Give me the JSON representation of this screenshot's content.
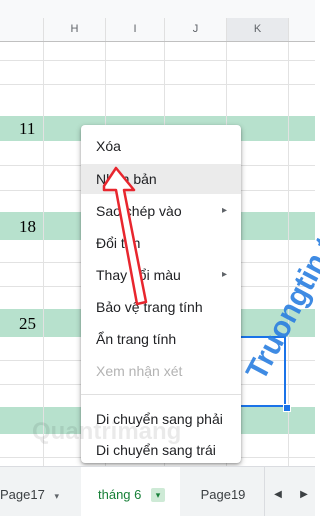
{
  "columns": {
    "h": "H",
    "i": "I",
    "j": "J",
    "k": "K"
  },
  "rows": {
    "r1": "11",
    "r2": "18",
    "r3": "25"
  },
  "menu": {
    "delete": "Xóa",
    "duplicate": "Nhân bản",
    "copy_to": "Sao chép vào",
    "rename": "Đổi tên",
    "change_color": "Thay đổi màu",
    "protect": "Bảo vệ trang tính",
    "hide": "Ẩn trang tính",
    "view_comments": "Xem nhận xét",
    "move_right": "Di chuyển sang phải",
    "move_left": "Di chuyển sang trái",
    "submenu_arrow": "▸"
  },
  "tabs": {
    "t1": "Page17",
    "t2": "tháng 6",
    "t3": "Page19",
    "dropdown": "▾",
    "prev": "◀",
    "next": "▶"
  },
  "watermark": {
    "brand": "Truongtin.top",
    "faint": "Quantrimang"
  },
  "colors": {
    "band": "#b7e1cd",
    "selection": "#1a73e8",
    "active_tab_text": "#188038",
    "arrow": "#e8262e",
    "watermark": "#2b7fe0"
  }
}
